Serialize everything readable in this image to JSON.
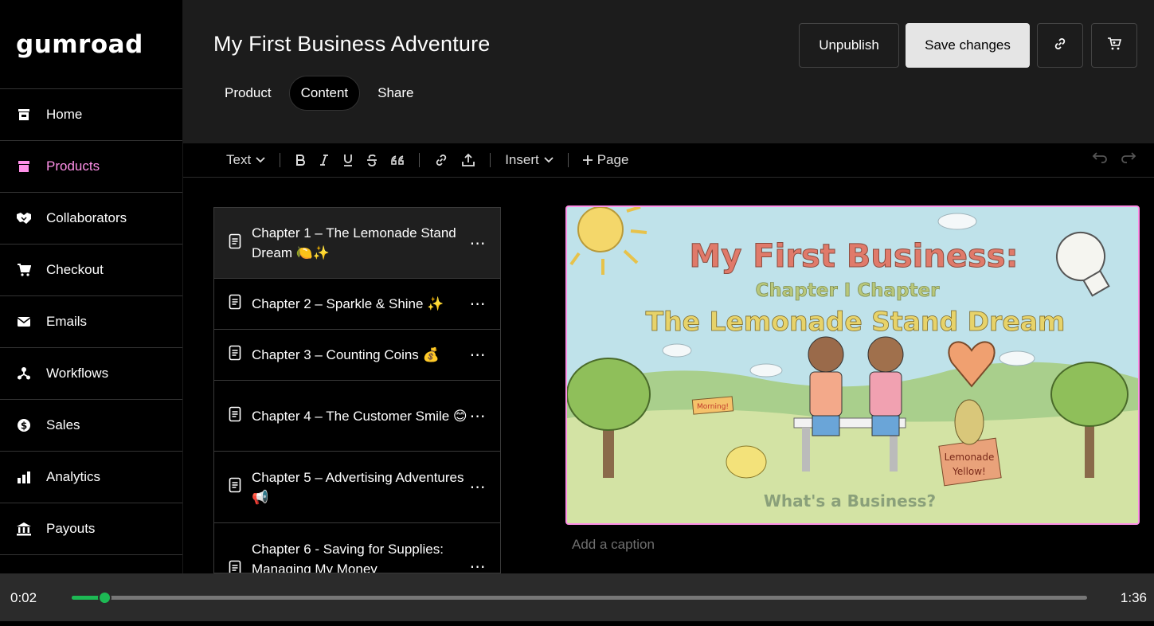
{
  "brand": {
    "logo_text": "Gumroad",
    "accent": "#ff90e8"
  },
  "sidebar": {
    "items": [
      {
        "label": "Home",
        "icon": "store-icon"
      },
      {
        "label": "Products",
        "icon": "product-box-icon",
        "active": true
      },
      {
        "label": "Collaborators",
        "icon": "handshake-icon"
      },
      {
        "label": "Checkout",
        "icon": "cart-icon"
      },
      {
        "label": "Emails",
        "icon": "envelope-icon"
      },
      {
        "label": "Workflows",
        "icon": "workflow-icon"
      },
      {
        "label": "Sales",
        "icon": "dollar-circle-icon"
      },
      {
        "label": "Analytics",
        "icon": "bar-chart-icon"
      },
      {
        "label": "Payouts",
        "icon": "bank-icon"
      }
    ]
  },
  "header": {
    "title": "My First Business Adventure",
    "tabs": [
      {
        "label": "Product"
      },
      {
        "label": "Content",
        "active": true
      },
      {
        "label": "Share"
      }
    ],
    "unpublish_label": "Unpublish",
    "save_label": "Save changes",
    "link_icon": "link-icon",
    "cart_icon": "cart-icon"
  },
  "toolbar": {
    "text_label": "Text",
    "insert_label": "Insert",
    "page_label": "Page"
  },
  "chapters": [
    {
      "title": "Chapter 1 – The Lemonade Stand Dream 🍋✨",
      "active": true
    },
    {
      "title": "Chapter 2 – Sparkle & Shine ✨"
    },
    {
      "title": "Chapter 3 – Counting Coins 💰"
    },
    {
      "title": "Chapter 4 – The Customer Smile 😊"
    },
    {
      "title": "Chapter 5 – Advertising Adventures 📢"
    },
    {
      "title": "Chapter 6 - Saving for Supplies: Managing My Money"
    }
  ],
  "cover_image": {
    "title": "My First Business:",
    "subtitle": "Chapter I Chapter",
    "heading": "The Lemonade Stand Dream",
    "footer": "What's a Business?",
    "sign_left": "Morning!",
    "sign_right_1": "Lemonade",
    "sign_right_2": "Yellow!"
  },
  "caption_placeholder": "Add a caption",
  "player": {
    "current_time": "0:02",
    "duration": "1:36",
    "progress": 0.032,
    "accent": "#1db954"
  }
}
